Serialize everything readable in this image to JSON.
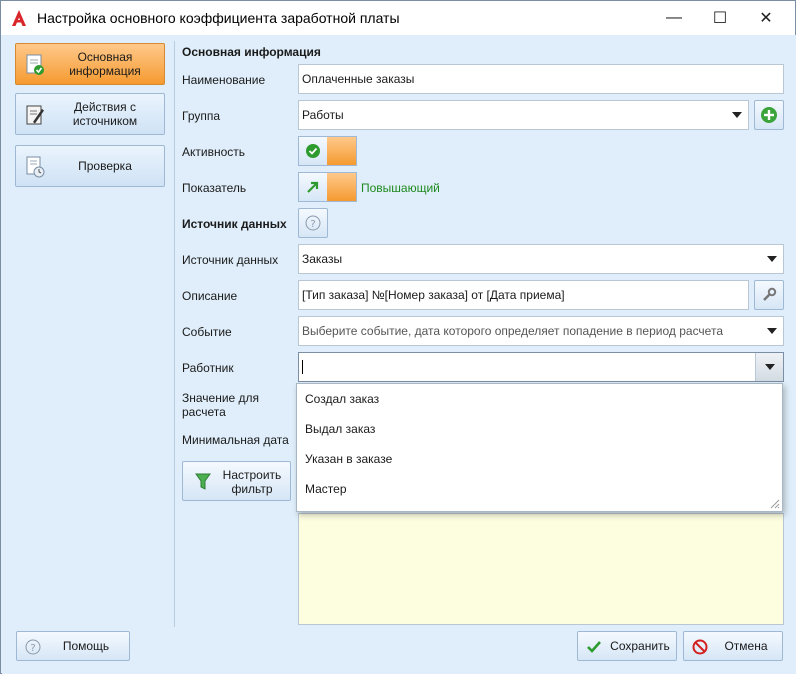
{
  "window": {
    "title": "Настройка основного коэффициента заработной платы",
    "minimize": "—",
    "maximize": "☐",
    "close": "✕"
  },
  "nav": {
    "items": [
      {
        "label": "Основная информация",
        "active": true
      },
      {
        "label": "Действия с источником",
        "active": false
      },
      {
        "label": "Проверка",
        "active": false
      }
    ]
  },
  "main": {
    "section_main": "Основная информация",
    "name_label": "Наименование",
    "name_value": "Оплаченные заказы",
    "group_label": "Группа",
    "group_value": "Работы",
    "active_label": "Активность",
    "indicator_label": "Показатель",
    "indicator_value": "Повышающий",
    "section_source": "Источник данных",
    "source_label": "Источник данных",
    "source_value": "Заказы",
    "description_label": "Описание",
    "description_value": "[Тип заказа] №[Номер  заказа] от [Дата приема]",
    "event_label": "Событие",
    "event_placeholder": "Выберите событие, дата которого определяет попадение в период расчета",
    "worker_label": "Работник",
    "worker_value": "",
    "calc_value_label": "Значение для расчета",
    "min_date_label": "Минимальная дата",
    "filter_button": "Настроить фильтр"
  },
  "worker_dropdown": {
    "options": [
      "Создал  заказ",
      "Выдал заказ",
      "Указан в заказе",
      "Мастер"
    ]
  },
  "footer": {
    "help": "Помощь",
    "save": "Сохранить",
    "cancel": "Отмена"
  },
  "colors": {
    "accent_orange": "#f59a30",
    "positive_green": "#1f8a1f",
    "background": "#dfeefa"
  }
}
